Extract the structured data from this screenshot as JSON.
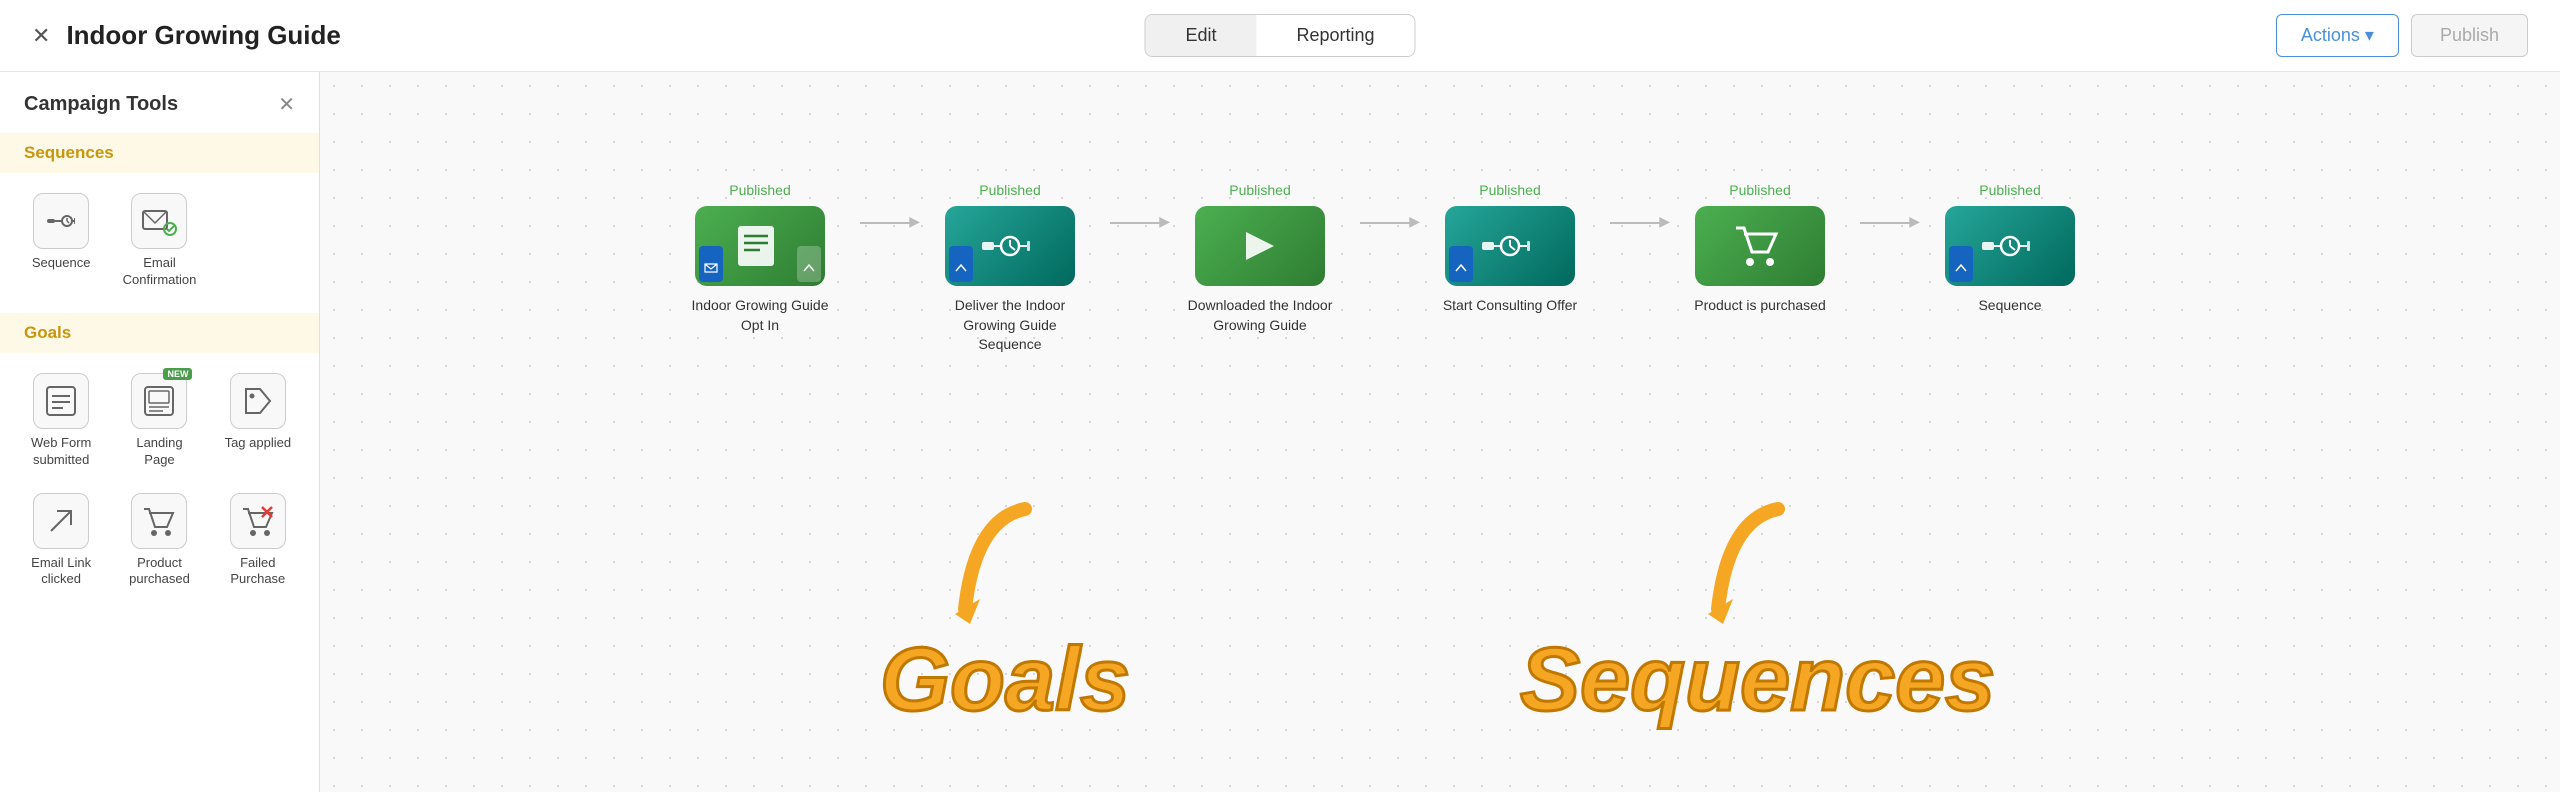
{
  "header": {
    "close_icon": "✕",
    "title": "Indoor Growing Guide",
    "tabs": [
      {
        "label": "Edit",
        "active": true
      },
      {
        "label": "Reporting",
        "active": false
      }
    ],
    "actions_label": "Actions ▾",
    "publish_label": "Publish"
  },
  "sidebar": {
    "title": "Campaign Tools",
    "close_icon": "✕",
    "sequences_label": "Sequences",
    "goals_label": "Goals",
    "sequences_tools": [
      {
        "icon": "⏱",
        "label": "Sequence"
      },
      {
        "icon": "✉✓",
        "label": "Email\nConfirmation"
      }
    ],
    "goals_tools": [
      {
        "icon": "▦",
        "label": "Web Form\nsubmitted"
      },
      {
        "icon": "▤",
        "label": "Landing\nPage",
        "new": true
      },
      {
        "icon": "🏷",
        "label": "Tag applied"
      },
      {
        "icon": "↖",
        "label": "Email Link\nclicked"
      },
      {
        "icon": "🛒",
        "label": "Product\npurchased"
      },
      {
        "icon": "🛒✕",
        "label": "Failed\nPurchase"
      }
    ]
  },
  "flow": {
    "nodes": [
      {
        "published": "Published",
        "icon": "📋",
        "label": "Indoor Growing Guide\nOpt In",
        "type": "green",
        "corner_bl": "🔵",
        "corner_br": "🔵"
      },
      {
        "published": "Published",
        "icon": "⏱",
        "label": "Deliver the Indoor\nGrowing Guide\nSequence",
        "type": "seq"
      },
      {
        "published": "Published",
        "icon": "▶",
        "label": "Downloaded the Indoor\nGrowing Guide",
        "type": "green"
      },
      {
        "published": "Published",
        "icon": "⏱",
        "label": "Start Consulting Offer",
        "type": "seq"
      },
      {
        "published": "Published",
        "icon": "🛒",
        "label": "Product is purchased",
        "type": "green"
      },
      {
        "published": "Published",
        "icon": "⏱",
        "label": "Sequence",
        "type": "seq"
      }
    ]
  },
  "annotations": {
    "goals_arrow": "↑",
    "goals_label": "Goals",
    "sequences_arrow": "↑",
    "sequences_label": "Sequences"
  }
}
